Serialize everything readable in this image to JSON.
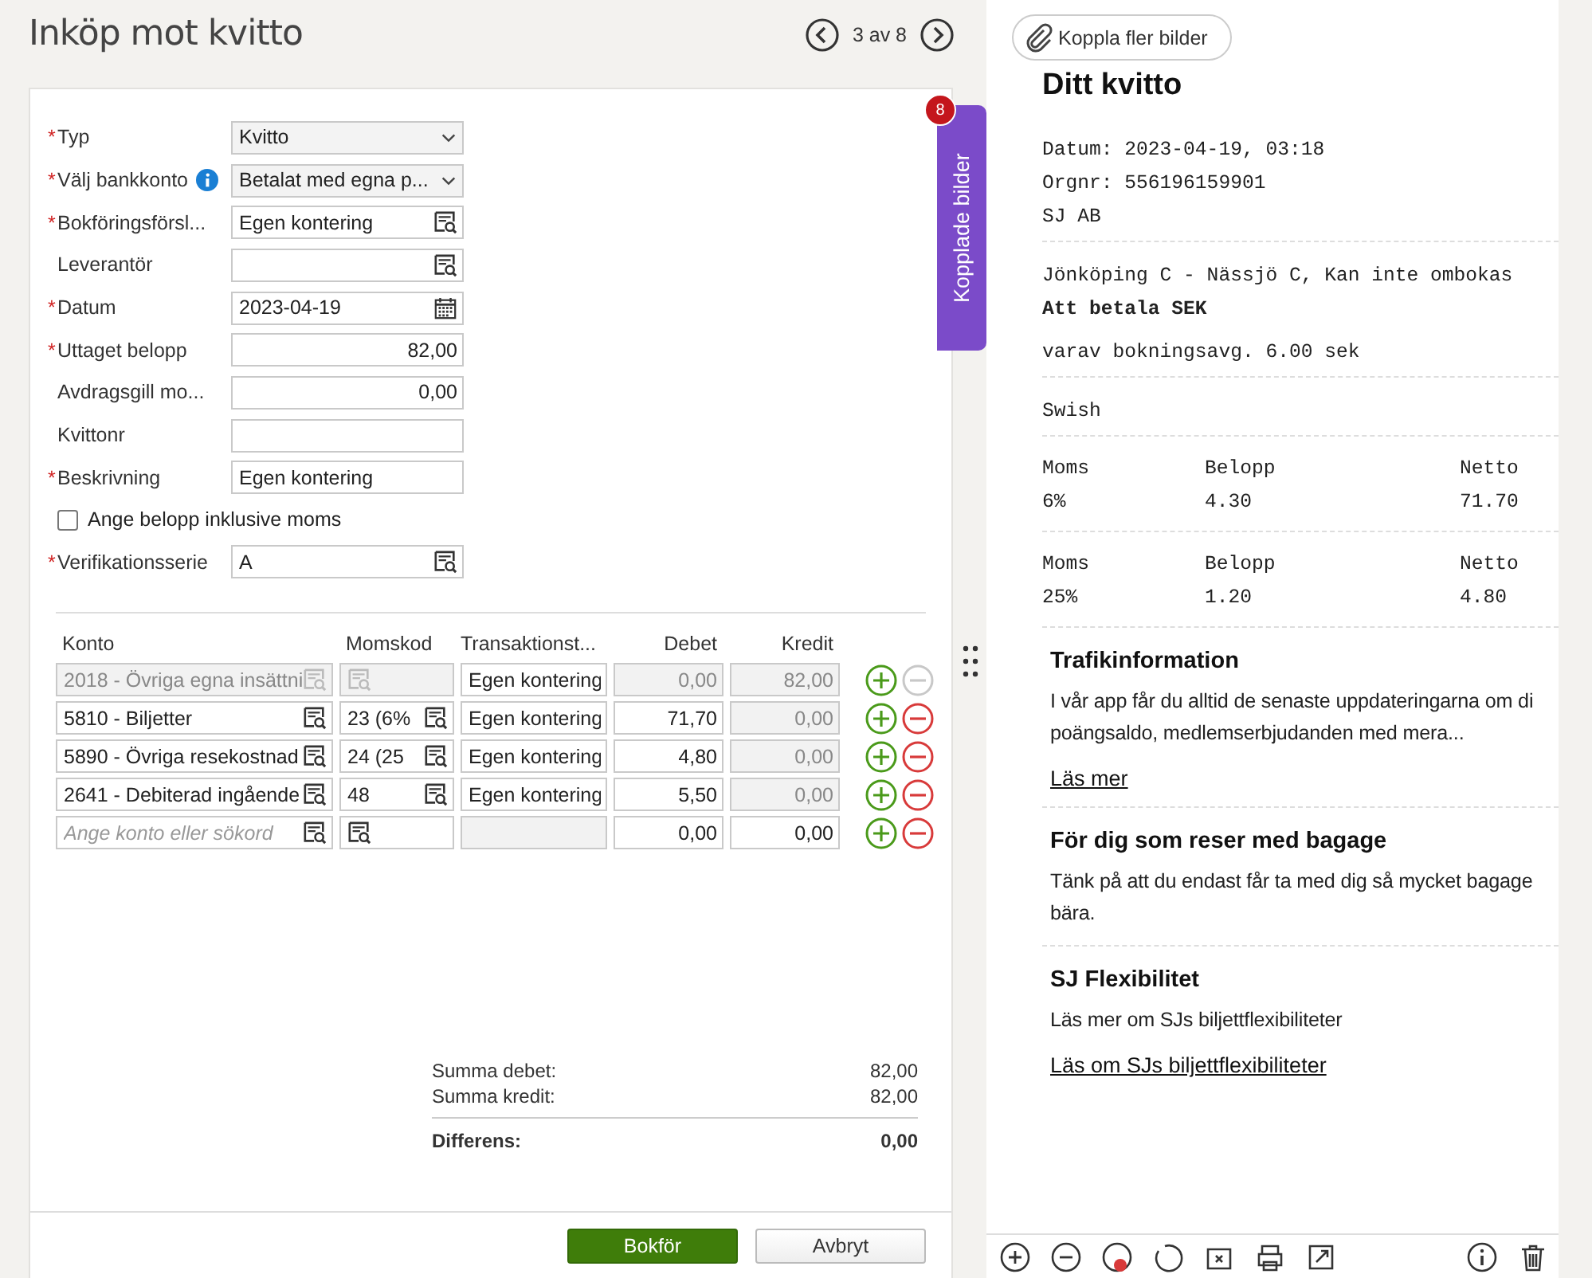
{
  "header": {
    "title": "Inköp mot kvitto",
    "pager": "3 av 8"
  },
  "form": {
    "fields": [
      {
        "label": "Typ",
        "marker": "*",
        "kind": "select",
        "value": "Kvitto"
      },
      {
        "label": "Välj bankkonto",
        "marker": "*",
        "kind": "select",
        "value": "Betalat med egna p...",
        "info": true
      },
      {
        "label": "Bokföringsförsl...",
        "marker": "*",
        "kind": "lookup",
        "value": "Egen kontering"
      },
      {
        "label": "Leverantör",
        "kind": "lookup"
      },
      {
        "label": "Datum",
        "marker": "*",
        "kind": "date",
        "value": "2023-04-19"
      },
      {
        "label": "Uttaget belopp",
        "marker": "*",
        "kind": "amount",
        "value": "82,00"
      },
      {
        "label": "Avdragsgill mo...",
        "kind": "amount",
        "value": "0,00"
      },
      {
        "label": "Kvittonr",
        "kind": "text"
      },
      {
        "label": "Beskrivning",
        "marker": "*",
        "kind": "text",
        "value": "Egen kontering"
      },
      {
        "label": "Ange belopp inklusive moms",
        "kind": "checkbox",
        "checked": false
      },
      {
        "label": "Verifikationsserie",
        "marker": "*",
        "kind": "lookup",
        "value": "A"
      }
    ]
  },
  "lines": {
    "columns": [
      "Konto",
      "Momskod",
      "Transaktionst...",
      "Debet",
      "Kredit"
    ],
    "rows": [
      {
        "konto": {
          "value": "2018 - Övriga egna insättni",
          "editable": false
        },
        "momskod": {
          "editable": false
        },
        "transaction": {
          "value": "Egen kontering",
          "editable": true
        },
        "debet": {
          "value": "0,00",
          "editable": false
        },
        "kredit": {
          "value": "82,00",
          "editable": false
        },
        "removable": false
      },
      {
        "konto": {
          "value": "5810 - Biljetter",
          "editable": true
        },
        "momskod": {
          "value": "23 (6%",
          "editable": true
        },
        "transaction": {
          "value": "Egen kontering",
          "editable": true
        },
        "debet": {
          "value": "71,70",
          "editable": true
        },
        "kredit": {
          "value": "0,00",
          "editable": false
        },
        "removable": true
      },
      {
        "konto": {
          "value": "5890 - Övriga resekostnad",
          "editable": true
        },
        "momskod": {
          "value": "24 (25",
          "editable": true
        },
        "transaction": {
          "value": "Egen kontering",
          "editable": true
        },
        "debet": {
          "value": "4,80",
          "editable": true
        },
        "kredit": {
          "value": "0,00",
          "editable": false
        },
        "removable": true
      },
      {
        "konto": {
          "value": "2641 - Debiterad ingående",
          "editable": true
        },
        "momskod": {
          "value": "48",
          "editable": true
        },
        "transaction": {
          "value": "Egen kontering",
          "editable": true
        },
        "debet": {
          "value": "5,50",
          "editable": true
        },
        "kredit": {
          "value": "0,00",
          "editable": false
        },
        "removable": true
      },
      {
        "konto": {
          "placeholder": "Ange konto eller sökord",
          "editable": true
        },
        "momskod": {
          "editable": true
        },
        "transaction": {
          "editable": false
        },
        "debet": {
          "value": "0,00",
          "editable": true
        },
        "kredit": {
          "value": "0,00",
          "editable": true
        },
        "removable": true
      }
    ]
  },
  "summary": [
    {
      "label": "Summa debet:",
      "value": "82,00",
      "kind": "sum"
    },
    {
      "label": "Summa kredit:",
      "value": "82,00",
      "kind": "sum"
    },
    {
      "label": "Differens:",
      "value": "0,00",
      "kind": "total"
    }
  ],
  "buttons": [
    {
      "label": "Bokför",
      "kind": "primary"
    },
    {
      "label": "Avbryt",
      "kind": "secondary"
    }
  ],
  "attachments_tab": {
    "label": "Kopplade bilder",
    "count": "8"
  },
  "viewer": {
    "attach_button": "Koppla fler bilder",
    "receipt": {
      "title": "Ditt kvitto",
      "sections": [
        {
          "kind": "lines",
          "items": [
            {
              "text": "Datum: 2023-04-19, 03:18",
              "bold": false
            },
            {
              "text": "Orgnr: 556196159901",
              "bold": false
            },
            {
              "text": "SJ AB",
              "bold": false
            }
          ]
        },
        {
          "kind": "lines",
          "items": [
            {
              "text": "Jönköping C - Nässjö C, Kan inte ombokas",
              "bold": false
            },
            {
              "text": "Att betala SEK",
              "bold": true
            },
            {
              "text": "varav bokningsavg. 6.00 sek",
              "bold": false
            }
          ]
        },
        {
          "kind": "lines",
          "items": [
            {
              "text": "Swish",
              "bold": false
            }
          ]
        },
        {
          "kind": "vat",
          "header": [
            "Moms",
            "Belopp",
            "Netto"
          ],
          "values": [
            "6%",
            "4.30",
            "71.70"
          ]
        },
        {
          "kind": "vat",
          "header": [
            "Moms",
            "Belopp",
            "Netto"
          ],
          "values": [
            "25%",
            "1.20",
            "4.80"
          ]
        },
        {
          "kind": "info",
          "heading": "Trafikinformation",
          "lines": [
            "I vår app får du alltid de senaste uppdateringarna om di",
            "poängsaldo, medlemserbjudanden med mera..."
          ],
          "link": "Läs mer"
        },
        {
          "kind": "info",
          "heading": "För dig som reser med bagage",
          "lines": [
            "Tänk på att du endast får ta med dig så mycket bagage",
            "bära."
          ]
        },
        {
          "kind": "info",
          "heading": "SJ Flexibilitet",
          "lines": [
            "Läs mer om SJs biljettflexibiliteter"
          ],
          "link": "Läs om SJs biljettflexibiliteter"
        }
      ]
    }
  }
}
